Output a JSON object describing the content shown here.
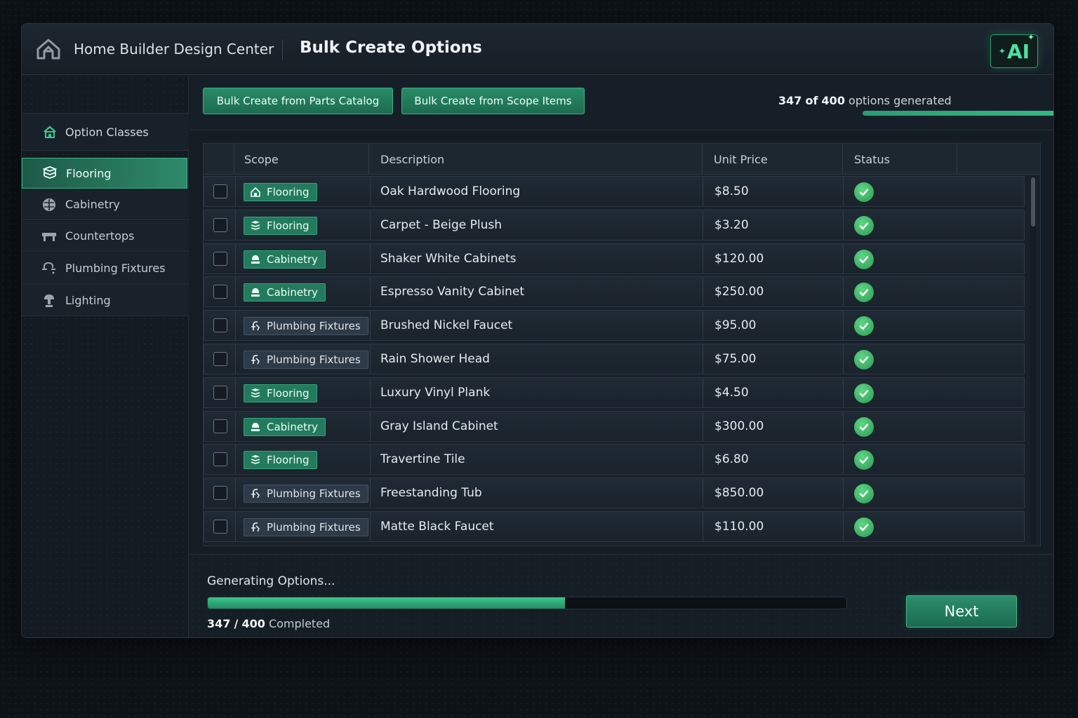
{
  "app": {
    "name": "Home Builder Design Center",
    "page_title": "Bulk Create Options",
    "ai_badge": "AI"
  },
  "sidebar": {
    "heading": "Option Classes",
    "items": [
      {
        "label": "Flooring",
        "icon": "flooring-icon",
        "active": true
      },
      {
        "label": "Cabinetry",
        "icon": "cabinetry-icon",
        "active": false
      },
      {
        "label": "Countertops",
        "icon": "countertop-icon",
        "active": false
      },
      {
        "label": "Plumbing Fixtures",
        "icon": "faucet-icon",
        "active": false
      },
      {
        "label": "Lighting",
        "icon": "lamp-icon",
        "active": false
      }
    ]
  },
  "toolbar": {
    "btn_parts": "Bulk Create from Parts Catalog",
    "btn_scope": "Bulk Create from Scope Items",
    "progress": {
      "done": "347",
      "of": "of",
      "total": "400",
      "suffix": "options generated",
      "fraction": 0.8675
    }
  },
  "table": {
    "columns": [
      "Scope",
      "Description",
      "Unit Price",
      "Status"
    ],
    "rows": [
      {
        "scope": "Flooring",
        "scope_style": "green",
        "scope_icon": "home-icon",
        "description": "Oak Hardwood Flooring",
        "price": "$8.50",
        "status": "complete"
      },
      {
        "scope": "Flooring",
        "scope_style": "green",
        "scope_icon": "flooring-icon",
        "description": "Carpet - Beige Plush",
        "price": "$3.20",
        "status": "complete"
      },
      {
        "scope": "Cabinetry",
        "scope_style": "green",
        "scope_icon": "cabinetry-icon",
        "description": "Shaker White Cabinets",
        "price": "$120.00",
        "status": "complete"
      },
      {
        "scope": "Cabinetry",
        "scope_style": "green",
        "scope_icon": "cabinetry-icon",
        "description": "Espresso Vanity Cabinet",
        "price": "$250.00",
        "status": "complete"
      },
      {
        "scope": "Plumbing Fixtures",
        "scope_style": "gray",
        "scope_icon": "faucet-icon",
        "description": "Brushed Nickel Faucet",
        "price": "$95.00",
        "status": "complete"
      },
      {
        "scope": "Plumbing Fixtures",
        "scope_style": "gray",
        "scope_icon": "faucet-icon",
        "description": "Rain Shower Head",
        "price": "$75.00",
        "status": "complete"
      },
      {
        "scope": "Flooring",
        "scope_style": "green",
        "scope_icon": "flooring-icon",
        "description": "Luxury Vinyl Plank",
        "price": "$4.50",
        "status": "complete"
      },
      {
        "scope": "Cabinetry",
        "scope_style": "green",
        "scope_icon": "cabinetry-icon",
        "description": "Gray Island Cabinet",
        "price": "$300.00",
        "status": "complete"
      },
      {
        "scope": "Flooring",
        "scope_style": "green",
        "scope_icon": "flooring-icon",
        "description": "Travertine Tile",
        "price": "$6.80",
        "status": "complete"
      },
      {
        "scope": "Plumbing Fixtures",
        "scope_style": "gray",
        "scope_icon": "faucet-icon",
        "description": "Freestanding Tub",
        "price": "$850.00",
        "status": "complete"
      },
      {
        "scope": "Plumbing Fixtures",
        "scope_style": "gray",
        "scope_icon": "faucet-icon",
        "description": "Matte Black Faucet",
        "price": "$110.00",
        "status": "complete"
      }
    ]
  },
  "footer": {
    "status": "Generating Options...",
    "done": "347",
    "slash": "/",
    "total": "400",
    "suffix": "Completed",
    "fraction": 0.5592,
    "next_label": "Next"
  },
  "colors": {
    "accent": "#2e8a6a",
    "accent_bright": "#3cc68f",
    "success": "#3fb86a",
    "background": "#141c24"
  }
}
